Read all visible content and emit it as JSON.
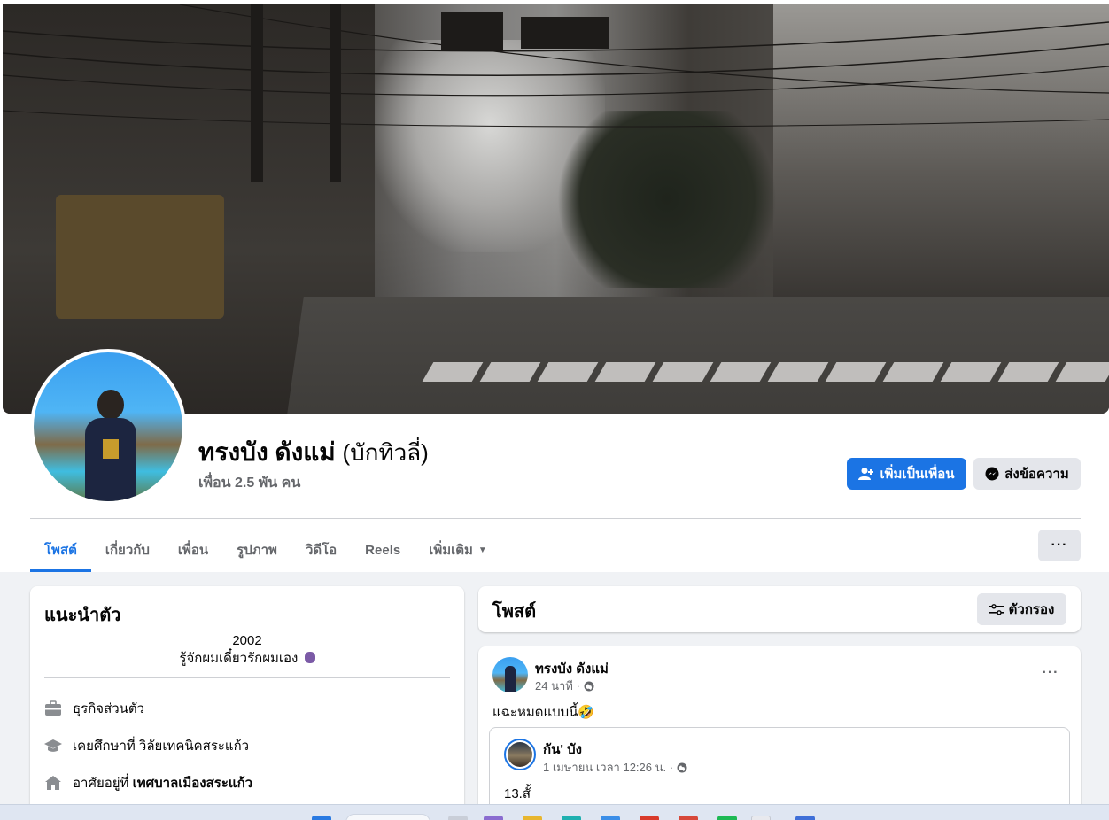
{
  "profile": {
    "name": "ทรงบัง ดังแม่",
    "alt_name": "(บักทิวลี่)",
    "friends": "เพื่อน 2.5 พัน คน"
  },
  "actions": {
    "add_friend": "เพิ่มเป็นเพื่อน",
    "message": "ส่งข้อความ"
  },
  "tabs": {
    "posts": "โพสต์",
    "about": "เกี่ยวกับ",
    "friends": "เพื่อน",
    "photos": "รูปภาพ",
    "videos": "วิดีโอ",
    "reels": "Reels",
    "more": "เพิ่มเติม",
    "menu": "···"
  },
  "intro": {
    "title": "แนะนำตัว",
    "bio_line1": "2002",
    "bio_line2": "รู้จักผมเดี๋ยวรักผมเอง",
    "work": "ธุรกิจส่วนตัว",
    "education_prefix": "เคยศึกษาที่ ",
    "education_place": "วิลัยเทคนิคสระแก้ว",
    "lives_prefix": "อาศัยอยู่ที่ ",
    "lives_place": "เทศบาลเมืองสระแก้ว"
  },
  "posts_header": {
    "title": "โพสต์",
    "filter": "ตัวกรอง"
  },
  "post": {
    "author": "ทรงบัง ดังแม่",
    "time": "24 นาที ·",
    "text": "แฉะหมดแบบนี้🤣",
    "menu": "···",
    "shared": {
      "author": "กัน' บัง",
      "time": "1 เมษายน เวลา 12:26 น. ·",
      "text": "13.สั้"
    }
  },
  "colors": {
    "primary": "#1b74e4",
    "secondary_button": "#e4e6eb",
    "page_bg": "#f0f2f5",
    "muted_text": "#65676b"
  }
}
